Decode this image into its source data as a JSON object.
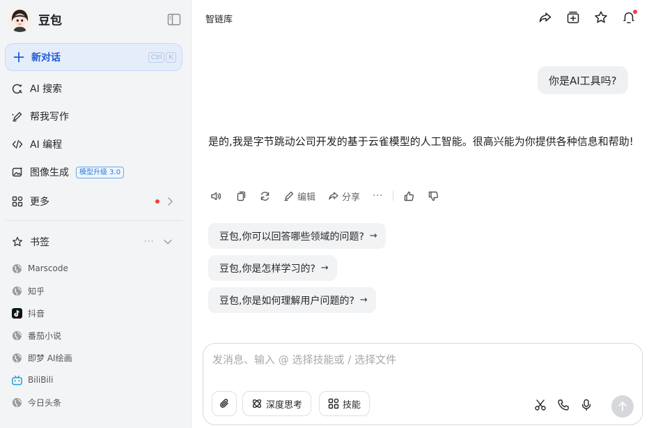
{
  "sidebar": {
    "brand_name": "豆包",
    "new_chat": {
      "label": "新对话",
      "kbd": [
        "Ctrl",
        "K"
      ]
    },
    "nav": [
      {
        "label": "AI 搜索",
        "icon": "ai-search-icon"
      },
      {
        "label": "帮我写作",
        "icon": "pen-icon"
      },
      {
        "label": "AI 编程",
        "icon": "code-icon"
      },
      {
        "label": "图像生成",
        "icon": "image-icon",
        "badge": "模型升级 3.0"
      },
      {
        "label": "更多",
        "icon": "grid-icon"
      }
    ],
    "bookmarks": {
      "title": "书签",
      "more": "···",
      "items": [
        {
          "label": "Marscode",
          "icon": "globe-icon"
        },
        {
          "label": "知乎",
          "icon": "globe-icon"
        },
        {
          "label": "抖音",
          "icon": "douyin-icon"
        },
        {
          "label": "番茄小说",
          "icon": "globe-icon"
        },
        {
          "label": "即梦 AI绘画",
          "icon": "globe-icon"
        },
        {
          "label": "BiliBili",
          "icon": "bilibili-icon"
        },
        {
          "label": "今日头条",
          "icon": "globe-icon"
        }
      ]
    }
  },
  "main": {
    "title": "智链库",
    "user_message": "你是AI工具吗?",
    "assistant_message": "是的,我是字节跳动公司开发的基于云雀模型的人工智能。很高兴能为你提供各种信息和帮助!",
    "actions": {
      "edit": "编辑",
      "share": "分享",
      "more": "···"
    },
    "suggestions": [
      "豆包,你可以回答哪些领域的问题?",
      "豆包,你是怎样学习的?",
      "豆包,你是如何理解用户问题的?"
    ],
    "suggestion_arrow": "→",
    "composer": {
      "placeholder": "发消息、输入 @ 选择技能或 / 选择文件",
      "deep_think": "深度思考",
      "skills": "技能"
    }
  },
  "colors": {
    "accent": "#1a5bd8",
    "new_chat_bg": "#e5edfb",
    "sidebar_bg": "#f3f4f6",
    "notification": "#f53f3f"
  }
}
